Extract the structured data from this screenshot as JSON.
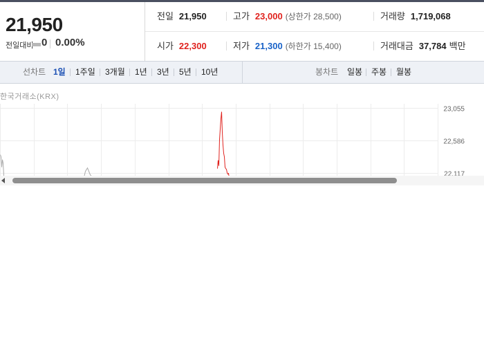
{
  "price": {
    "current": "21,950",
    "change_label": "전일대비",
    "change_value": "0",
    "change_rate": "0.00%"
  },
  "stats": {
    "prev_close": {
      "label": "전일",
      "value": "21,950"
    },
    "high": {
      "label": "고가",
      "value": "23,000",
      "limit": "(상한가 28,500)"
    },
    "volume": {
      "label": "거래량",
      "value": "1,719,068"
    },
    "open": {
      "label": "시가",
      "value": "22,300"
    },
    "low": {
      "label": "저가",
      "value": "21,300",
      "limit": "(하한가 15,400)"
    },
    "trade_value": {
      "label": "거래대금",
      "value": "37,784",
      "unit": "백만"
    }
  },
  "tabs": {
    "line_chart_label": "선차트",
    "periods": [
      "1일",
      "1주일",
      "3개월",
      "1년",
      "3년",
      "5년",
      "10년"
    ],
    "active_period": "1일",
    "candle_chart_label": "봉차트",
    "candles": [
      "일봉",
      "주봉",
      "월봉"
    ]
  },
  "exchange": "한국거래소(KRX)",
  "chart_data": {
    "type": "line",
    "title": "",
    "xlabel": "",
    "ylabel": "",
    "y_ticks": [
      "23,055",
      "22,586",
      "22,117"
    ],
    "ylim": [
      21950,
      23055
    ],
    "grid": true,
    "series": [
      {
        "color": "#aaaaaa",
        "x": [
          0,
          1,
          2,
          3,
          4,
          5,
          6,
          7,
          8,
          9,
          90,
          92,
          94,
          112,
          116,
          120,
          123,
          126,
          130,
          134,
          138,
          142,
          145,
          275,
          280,
          285,
          290,
          295
        ],
        "values": [
          22380,
          22350,
          22200,
          22310,
          22260,
          22080,
          22020,
          21990,
          21980,
          21970,
          21990,
          22040,
          21985,
          21990,
          22000,
          22010,
          22140,
          22190,
          22090,
          22050,
          22010,
          22040,
          22020,
          22000,
          22060,
          22020,
          22030,
          22000
        ]
      },
      {
        "color": "#e0221e",
        "x": [
          314,
          315,
          316,
          317,
          318,
          319,
          320,
          321,
          322,
          323,
          324,
          325,
          326,
          327,
          328,
          329,
          330,
          331
        ],
        "values": [
          22180,
          22300,
          22220,
          22600,
          22750,
          22900,
          23000,
          22700,
          22520,
          22400,
          22350,
          22200,
          22180,
          22170,
          22120,
          22100,
          22110,
          22050
        ]
      }
    ]
  },
  "colors": {
    "up": "#e0221e",
    "down": "#1a63c8",
    "accent": "#1a4fb3"
  }
}
